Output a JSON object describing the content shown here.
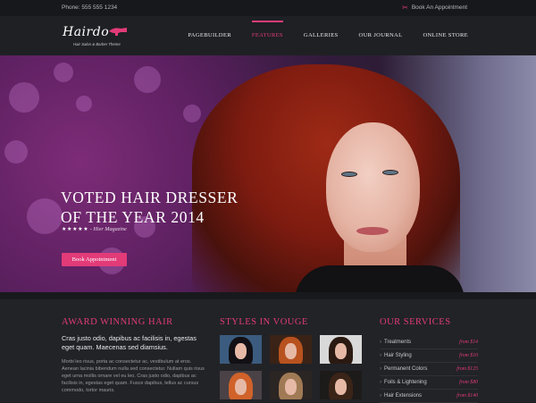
{
  "topbar": {
    "phone": "Phone: 555 555 1234",
    "appointment": "Book An Appointment",
    "appointment_icon": "scissors-icon"
  },
  "logo": {
    "wordmark": "Hairdo",
    "tagline": "Hair Salon & Barber Theme",
    "icon": "hair-dryer-icon"
  },
  "nav": {
    "items": [
      {
        "label": "PAGEBUILDER"
      },
      {
        "label": "FEATURES"
      },
      {
        "label": "GALLERIES"
      },
      {
        "label": "OUR JOURNAL"
      },
      {
        "label": "ONLINE STORE"
      }
    ],
    "active_index": 1
  },
  "hero": {
    "title_line1": "VOTED HAIR DRESSER",
    "title_line2": "OF THE YEAR 2014",
    "stars": "★★★★★",
    "quote_source": "- Hier Magazine",
    "button": "Book Appointment",
    "slide_count": 2,
    "active_slide": 2
  },
  "sections": {
    "award": {
      "heading": "AWARD WINNING HAIR",
      "lead": "Cras justo odio, dapibus ac facilisis in, egestas eget quam. Maecenas sed diamsius.",
      "body": "Morbi leo risus, porta ac consectetur ac, vestibulum at eros. Aenean lacinia bibendum nulla sed consectetur. Nullam quis risus eget urna mollis ornare vel eu leo. Cras justo odio, dapibus ac facilisis in, egestas eget quam. Fusce dapibus, tellus ac cursus commodo, tortor mauris."
    },
    "styles": {
      "heading": "STYLES IN VOUGE",
      "thumbnails": [
        "style-photo-1",
        "style-photo-2",
        "style-photo-3",
        "style-photo-4",
        "style-photo-5",
        "style-photo-6"
      ]
    },
    "services": {
      "heading": "OUR SERVICES",
      "items": [
        {
          "name": "Treatments",
          "price": "from $14"
        },
        {
          "name": "Hair Styling",
          "price": "from $10"
        },
        {
          "name": "Permanent Colors",
          "price": "from $125"
        },
        {
          "name": "Foils & Lightening",
          "price": "from $80"
        },
        {
          "name": "Hair Extensions",
          "price": "from $140"
        }
      ]
    }
  },
  "colors": {
    "accent": "#e23b78",
    "background": "#1f2024",
    "topbar": "#17181b"
  }
}
